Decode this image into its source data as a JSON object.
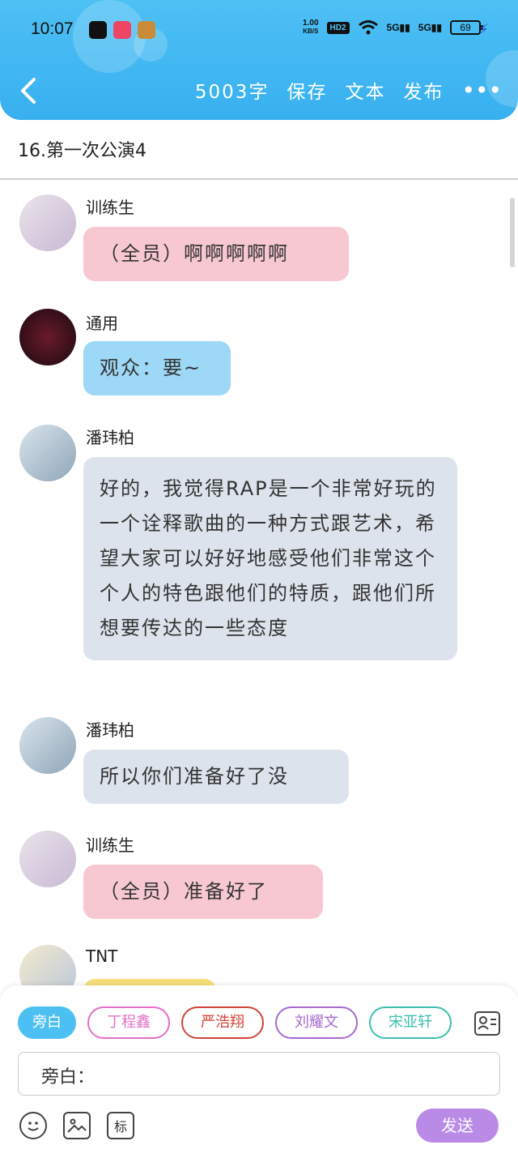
{
  "status_bar": {
    "time": "10:07",
    "net_speed_value": "1.00",
    "net_speed_unit": "KB/S",
    "hd": "HD2",
    "signal_1": "5G",
    "signal_2": "5G",
    "battery": "69"
  },
  "header": {
    "word_count": "5003字",
    "save": "保存",
    "text": "文本",
    "publish": "发布",
    "more": "•••"
  },
  "chapter_title": "16.第一次公演4",
  "messages": [
    {
      "name": "训练生",
      "text": "（全员）啊啊啊啊啊",
      "color": "#f8c8d2"
    },
    {
      "name": "通用",
      "text": "观众：要~",
      "color": "#9dd8f6"
    },
    {
      "name": "潘玮柏",
      "text": "好的，我觉得RAP是一个非常好玩的一个诠释歌曲的一种方式跟艺术，希望大家可以好好地感受他们非常这个个人的特色跟他们的特质，跟他们所想要传达的一些态度",
      "color": "#dde3ec"
    },
    {
      "name": "潘玮柏",
      "text": "所以你们准备好了没",
      "color": "#dde3ec"
    },
    {
      "name": "训练生",
      "text": "（全员）准备好了",
      "color": "#f8c8d2"
    },
    {
      "name": "TNT",
      "text": "",
      "color": "#f7e07a"
    }
  ],
  "input_panel": {
    "roles": [
      {
        "label": "旁白",
        "color": "#4cc0f2"
      },
      {
        "label": "丁程鑫",
        "color": "#e26fc8"
      },
      {
        "label": "严浩翔",
        "color": "#d0443a"
      },
      {
        "label": "刘耀文",
        "color": "#a569cf"
      },
      {
        "label": "宋亚轩",
        "color": "#3bbfb0"
      }
    ],
    "input_value": "旁白：",
    "tag_tool": "标",
    "send": "发送"
  }
}
